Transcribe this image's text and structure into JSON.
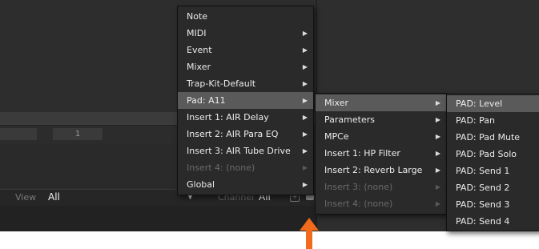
{
  "background": {
    "view_label": "View",
    "view_value": "All",
    "channel_label": "Channel",
    "channel_value": "All",
    "field_value": "1"
  },
  "menu_main": {
    "items": [
      {
        "label": "Note",
        "has_submenu": false
      },
      {
        "label": "MIDI",
        "has_submenu": true
      },
      {
        "label": "Event",
        "has_submenu": true
      },
      {
        "label": "Mixer",
        "has_submenu": true
      },
      {
        "label": "Trap-Kit-Default",
        "has_submenu": true
      },
      {
        "label": "Pad: A11",
        "has_submenu": true,
        "highlighted": true
      },
      {
        "label": "Insert 1: AIR Delay",
        "has_submenu": true
      },
      {
        "label": "Insert 2: AIR Para EQ",
        "has_submenu": true
      },
      {
        "label": "Insert 3: AIR Tube Drive",
        "has_submenu": true
      },
      {
        "label": "Insert 4: (none)",
        "has_submenu": true,
        "disabled": true
      },
      {
        "label": "Global",
        "has_submenu": true
      }
    ]
  },
  "menu_pad": {
    "items": [
      {
        "label": "Mixer",
        "has_submenu": true,
        "highlighted": true
      },
      {
        "label": "Parameters",
        "has_submenu": true
      },
      {
        "label": "MPCe",
        "has_submenu": true
      },
      {
        "label": "Insert 1: HP Filter",
        "has_submenu": true
      },
      {
        "label": "Insert 2: Reverb Large",
        "has_submenu": true
      },
      {
        "label": "Insert 3: (none)",
        "has_submenu": true,
        "disabled": true
      },
      {
        "label": "Insert 4: (none)",
        "has_submenu": true,
        "disabled": true
      }
    ]
  },
  "menu_mixer": {
    "items": [
      {
        "label": "PAD: Level",
        "highlighted": true
      },
      {
        "label": "PAD: Pan"
      },
      {
        "label": "PAD: Pad Mute"
      },
      {
        "label": "PAD: Pad Solo"
      },
      {
        "label": "PAD: Send 1"
      },
      {
        "label": "PAD: Send 2"
      },
      {
        "label": "PAD: Send 3"
      },
      {
        "label": "PAD: Send 4"
      }
    ]
  },
  "colors": {
    "menu_bg": "#2a2a2a",
    "highlight": "#5a5a5a",
    "disabled_text": "#6a6a6a",
    "annotation_arrow": "#f26a1b"
  },
  "icons": {
    "submenu": "caret-right-icon",
    "annotation": "arrow-up-icon"
  }
}
